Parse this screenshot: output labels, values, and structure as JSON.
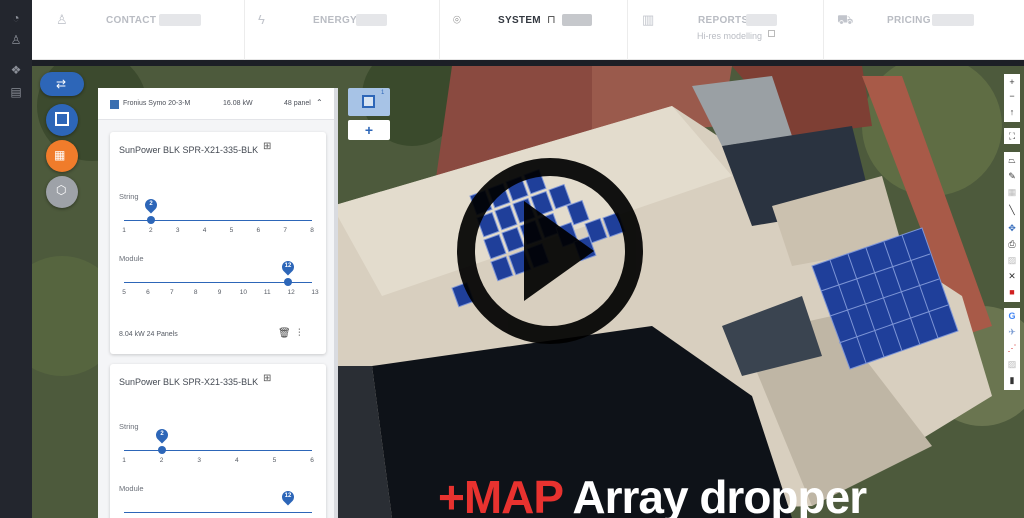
{
  "nav": {
    "contact": "CONTACT",
    "energy": "ENERGY",
    "system": "SYSTEM",
    "reports": "REPORTS",
    "reports_sub": "Hi-res modelling",
    "pricing": "PRICING"
  },
  "inverter": {
    "name": "Fronius Symo 20-3-M",
    "power": "16.08 kW",
    "panels": "48 panel"
  },
  "cards": [
    {
      "title": "SunPower BLK SPR-X21-335-BLK",
      "string_label": "String",
      "string_value": "2",
      "string_ticks": [
        "1",
        "2",
        "3",
        "4",
        "5",
        "6",
        "7",
        "8"
      ],
      "module_label": "Module",
      "module_value": "12",
      "module_ticks": [
        "5",
        "6",
        "7",
        "8",
        "9",
        "10",
        "11",
        "12",
        "13"
      ],
      "footer": "8.04 kW 24 Panels"
    },
    {
      "title": "SunPower BLK SPR-X21-335-BLK",
      "string_label": "String",
      "string_value": "2",
      "string_ticks": [
        "1",
        "2",
        "3",
        "4",
        "5",
        "6"
      ],
      "module_label": "Module",
      "module_value": "12"
    }
  ],
  "array_badge": "1",
  "add_label": "+",
  "caption": {
    "prefix": "+MAP",
    "rest": "Array dropper"
  },
  "colors": {
    "accent_blue": "#2d66b8",
    "caption_red": "#e8322f",
    "panel_blue": "#1f3f9a",
    "orange_button": "#f07c2b"
  }
}
